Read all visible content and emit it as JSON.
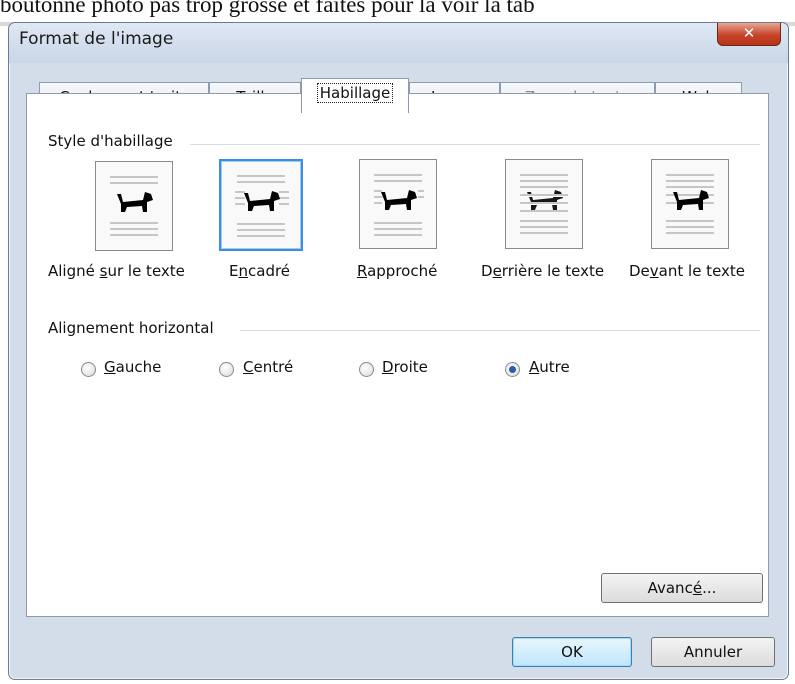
{
  "background_text": "boutonne photo pas trop grosse et faites pour la voir la tab",
  "window": {
    "title": "Format de l'image",
    "close_glyph": "✕"
  },
  "tabs": [
    {
      "label": "Couleurs et traits",
      "state": "normal"
    },
    {
      "label": "Taille",
      "state": "normal"
    },
    {
      "label": "Habillage",
      "state": "active"
    },
    {
      "label": "Image",
      "state": "normal"
    },
    {
      "label": "Zone de texte",
      "state": "disabled"
    },
    {
      "label": "Web",
      "state": "normal"
    }
  ],
  "wrap_style": {
    "group_label": "Style d'habillage",
    "options": [
      {
        "pre": "Aligné ",
        "key": "s",
        "post": "ur le texte",
        "icon": "inline-wrap-icon",
        "selected": false
      },
      {
        "pre": "E",
        "key": "n",
        "post": "cadré",
        "icon": "square-wrap-icon",
        "selected": true
      },
      {
        "pre": "",
        "key": "R",
        "post": "approché",
        "icon": "tight-wrap-icon",
        "selected": false
      },
      {
        "pre": "D",
        "key": "e",
        "post": "rrière le texte",
        "icon": "behind-text-icon",
        "selected": false
      },
      {
        "pre": "De",
        "key": "v",
        "post": "ant le texte",
        "icon": "in-front-text-icon",
        "selected": false
      }
    ]
  },
  "horizontal_alignment": {
    "group_label": "Alignement horizontal",
    "options": [
      {
        "pre": "",
        "key": "G",
        "post": "auche",
        "checked": false
      },
      {
        "pre": "",
        "key": "C",
        "post": "entré",
        "checked": false
      },
      {
        "pre": "",
        "key": "D",
        "post": "roite",
        "checked": false
      },
      {
        "pre": "",
        "key": "A",
        "post": "utre",
        "checked": true
      }
    ]
  },
  "buttons": {
    "advanced": {
      "pre": "Avanc",
      "key": "é",
      "post": "..."
    },
    "ok": "OK",
    "cancel": "Annuler"
  },
  "colors": {
    "selection_accent": "#3d8ee3",
    "radio_dot": "#2a5ea8",
    "close_red": "#c7442a"
  }
}
